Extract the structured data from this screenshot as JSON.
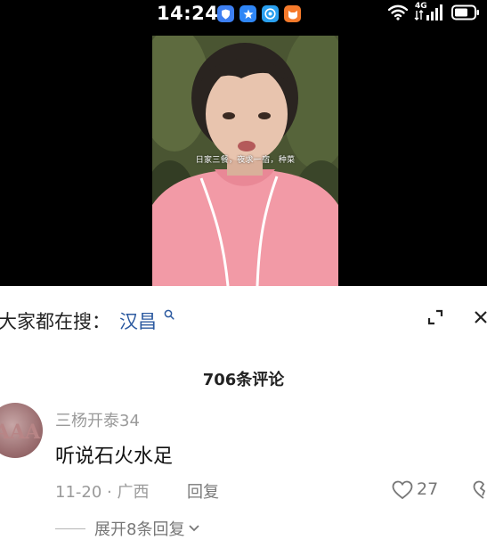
{
  "status_bar": {
    "time": "14:24",
    "network_label": "4G",
    "apps": [
      {
        "icon": "shield-app-icon",
        "color": "#3d7ff2"
      },
      {
        "icon": "star-app-icon",
        "color": "#2f86f6"
      },
      {
        "icon": "globe-app-icon",
        "color": "#2aa0f0"
      },
      {
        "icon": "fox-app-icon",
        "color": "#f57a2b"
      }
    ]
  },
  "video": {
    "subtitle": "日家三餐，夜求一宿，种菜"
  },
  "search": {
    "prefix": "大家都在搜：",
    "term": "汉昌",
    "term_color": "#2c5aa0"
  },
  "comments": {
    "header": "706条评论",
    "items": [
      {
        "username": "三杨开泰34",
        "text": "听说石火水足",
        "date_location": "11-20 · 广西",
        "reply_label": "回复",
        "likes": "27",
        "expand_replies": "展开8条回复"
      }
    ]
  }
}
